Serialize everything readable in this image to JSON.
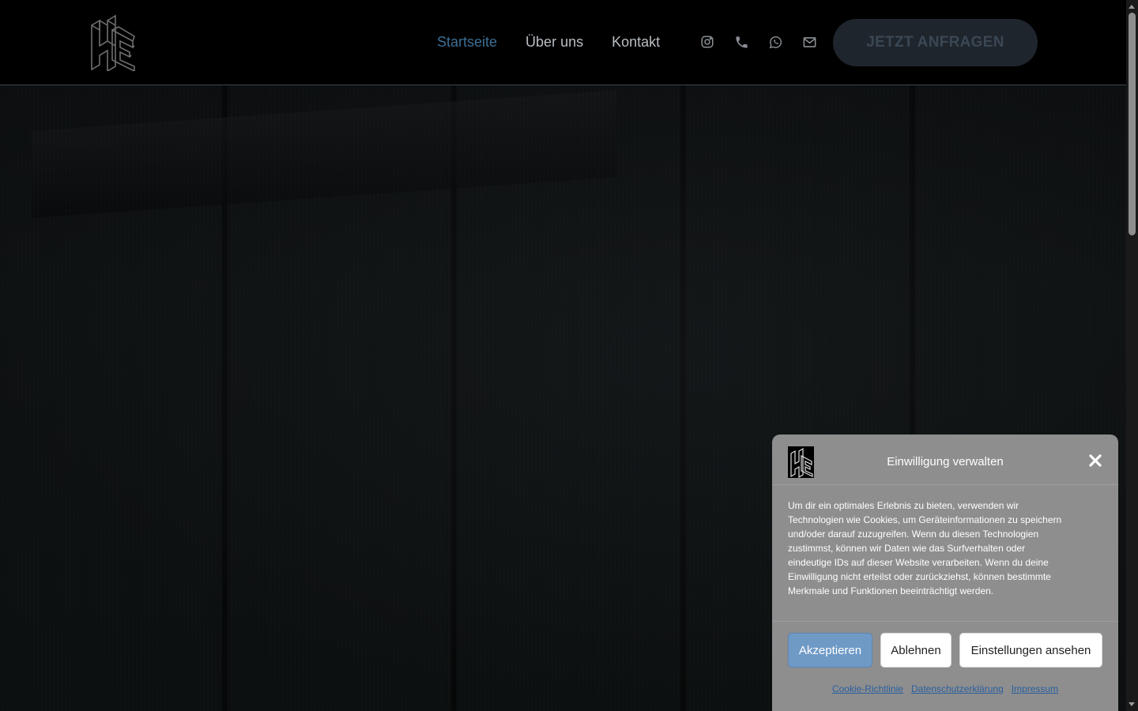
{
  "header": {
    "nav": [
      {
        "label": "Startseite",
        "active": true
      },
      {
        "label": "Über uns",
        "active": false
      },
      {
        "label": "Kontakt",
        "active": false
      }
    ],
    "social_icons": [
      "instagram-icon",
      "phone-icon",
      "whatsapp-icon",
      "mail-icon"
    ],
    "cta_label": "JETZT ANFRAGEN"
  },
  "cookie": {
    "title": "Einwilligung verwalten",
    "body": "Um dir ein optimales Erlebnis zu bieten, verwenden wir Technologien wie Cookies, um Geräteinformationen zu speichern und/oder darauf zuzugreifen. Wenn du diesen Technologien zustimmst, können wir Daten wie das Surfverhalten oder eindeutige IDs auf dieser Website verarbeiten. Wenn du deine Einwilligung nicht erteilst oder zurückziehst, können bestimmte Merkmale und Funktionen beeinträchtigt werden.",
    "accept_label": "Akzeptieren",
    "deny_label": "Ablehnen",
    "settings_label": "Einstellungen ansehen",
    "links": {
      "cookie_policy": "Cookie-Richtlinie",
      "privacy": "Datenschutzerklärung",
      "imprint": "Impressum"
    }
  },
  "colors": {
    "nav_active": "#3d6f94",
    "nav_default": "#b9bec4",
    "cta_bg": "#1f252c",
    "cta_text": "#3a4754",
    "cookie_bg": "#8e8e8e",
    "accept_bg": "#6f9ac6",
    "link": "#2a5fa0"
  }
}
